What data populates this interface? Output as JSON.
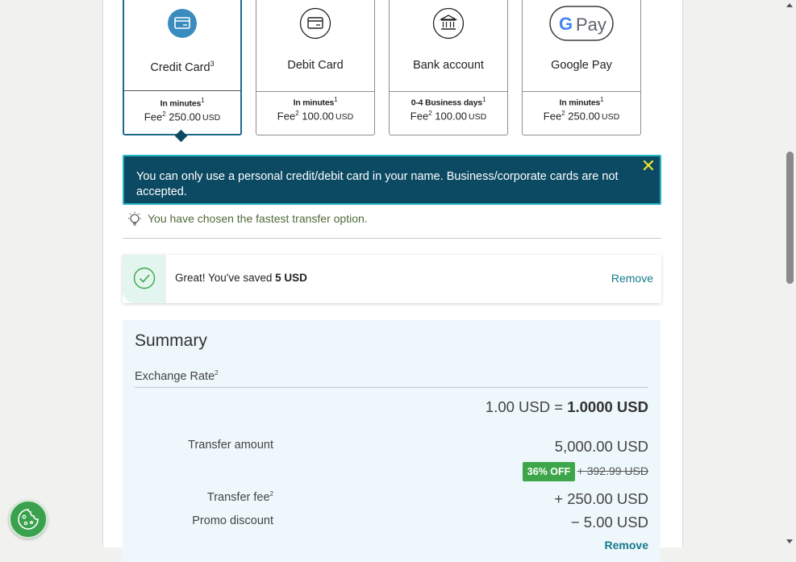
{
  "payment_methods": [
    {
      "id": "credit-card",
      "name": "Credit Card",
      "name_sup": "3",
      "speed": "In minutes",
      "speed_sup": "1",
      "fee_label": "Fee",
      "fee_sup": "2",
      "fee_amount": "250.00",
      "fee_currency": "USD",
      "icon": "credit-card-icon",
      "selected": true
    },
    {
      "id": "debit-card",
      "name": "Debit Card",
      "name_sup": "",
      "speed": "In minutes",
      "speed_sup": "1",
      "fee_label": "Fee",
      "fee_sup": "2",
      "fee_amount": "100.00",
      "fee_currency": "USD",
      "icon": "debit-card-icon",
      "selected": false
    },
    {
      "id": "bank-account",
      "name": "Bank account",
      "name_sup": "",
      "speed": "0-4 Business days",
      "speed_sup": "1",
      "fee_label": "Fee",
      "fee_sup": "2",
      "fee_amount": "100.00",
      "fee_currency": "USD",
      "icon": "bank-icon",
      "selected": false
    },
    {
      "id": "google-pay",
      "name": "Google Pay",
      "name_sup": "",
      "speed": "In minutes",
      "speed_sup": "1",
      "fee_label": "Fee",
      "fee_sup": "2",
      "fee_amount": "250.00",
      "fee_currency": "USD",
      "icon": "google-pay-logo",
      "selected": false
    }
  ],
  "google_pay_logo": {
    "g": "G",
    "pay": "Pay"
  },
  "alert": {
    "text": "You can only use a personal credit/debit card in your name. Business/corporate cards are not accepted.",
    "close_glyph": "✕"
  },
  "hint": {
    "text": "You have chosen the fastest transfer option."
  },
  "promo": {
    "text": "Great! You've saved ",
    "amount": "5 USD",
    "remove_label": "Remove"
  },
  "summary": {
    "title": "Summary",
    "exchange_rate_label": "Exchange Rate",
    "exchange_rate_sup": "2",
    "rate_lhs": "1.00 USD = ",
    "rate_rhs": "1.0000 USD",
    "transfer_amount_label": "Transfer amount",
    "transfer_amount_value": "5,000.00 USD",
    "discount_badge": "36% OFF",
    "original_fee": "+ 392.99 USD",
    "transfer_fee_label": "Transfer fee",
    "transfer_fee_sup": "2",
    "transfer_fee_value": "+ 250.00 USD",
    "promo_discount_label": "Promo discount",
    "promo_discount_value": "− 5.00 USD",
    "remove_label": "Remove"
  },
  "colors": {
    "primary_dark": "#0c4a63",
    "accent_teal": "#157a8c",
    "success_green": "#3ea64a",
    "alert_close": "#f1e32a"
  }
}
